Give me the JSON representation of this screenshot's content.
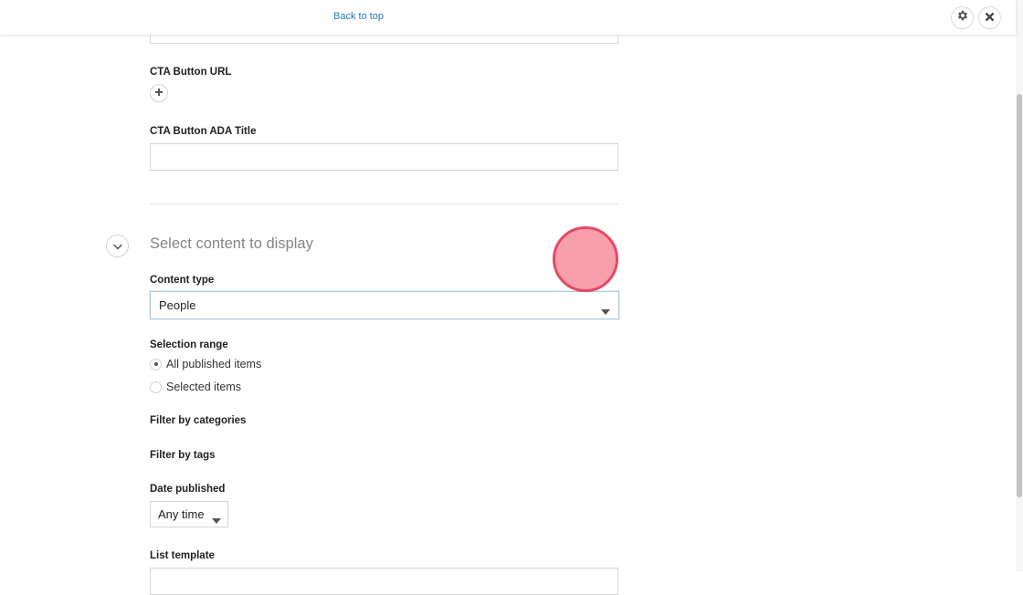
{
  "header": {
    "back_to_top": "Back to top"
  },
  "form": {
    "cta_url_label": "CTA Button URL",
    "cta_ada_title_label": "CTA Button ADA Title",
    "cta_ada_title_value": "",
    "section_title": "Select content to display",
    "content_type_label": "Content type",
    "content_type_value": "People",
    "selection_range_label": "Selection range",
    "selection_options": [
      {
        "label": "All published items",
        "checked": true
      },
      {
        "label": "Selected items",
        "checked": false
      }
    ],
    "filter_categories_label": "Filter by categories",
    "filter_tags_label": "Filter by tags",
    "date_published_label": "Date published",
    "date_published_value": "Any time",
    "list_template_label": "List template"
  },
  "icons": {
    "settings": "gear-icon",
    "close": "close-icon",
    "add": "plus-icon",
    "collapse": "chevron-down-icon",
    "dropdown": "caret-down-icon"
  },
  "colors": {
    "link": "#2a7ab0",
    "cursor_fill": "#f78e9e",
    "cursor_border": "#e44a66",
    "select_focus_border": "#a9c8dd"
  }
}
